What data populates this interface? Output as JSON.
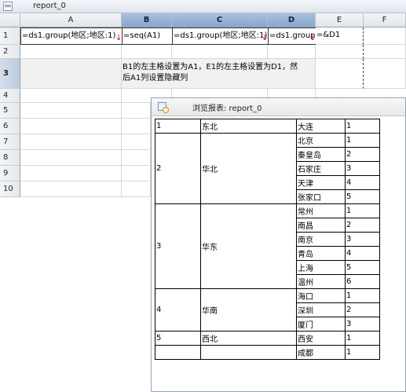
{
  "window": {
    "title": "report_0"
  },
  "columns": [
    "A",
    "B",
    "C",
    "D",
    "E",
    "F"
  ],
  "rows": [
    "1",
    "2",
    "3",
    "4",
    "5",
    "6",
    "7",
    "8",
    "9",
    "10"
  ],
  "cells": {
    "A1": "=ds1.group(地区;地区:1)",
    "B1": "=seq(A1)",
    "C1": "=ds1.group(地区;地区:1)",
    "D1": "=ds1.group(",
    "E1": "=&D1"
  },
  "note": {
    "line1": "B1的左主格设置为A1，E1的左主格设置为D1，然",
    "line2": "后A1列设置隐藏列"
  },
  "preview": {
    "title": "浏览报表: report_0",
    "groups": [
      {
        "seq": "1",
        "region": "东北",
        "cities": [
          {
            "name": "大连",
            "idx": "1"
          }
        ]
      },
      {
        "seq": "2",
        "region": "华北",
        "cities": [
          {
            "name": "北京",
            "idx": "1"
          },
          {
            "name": "秦皇岛",
            "idx": "2"
          },
          {
            "name": "石家庄",
            "idx": "3"
          },
          {
            "name": "天津",
            "idx": "4"
          },
          {
            "name": "张家口",
            "idx": "5"
          }
        ]
      },
      {
        "seq": "3",
        "region": "华东",
        "cities": [
          {
            "name": "常州",
            "idx": "1"
          },
          {
            "name": "南昌",
            "idx": "2"
          },
          {
            "name": "南京",
            "idx": "3"
          },
          {
            "name": "青岛",
            "idx": "4"
          },
          {
            "name": "上海",
            "idx": "5"
          },
          {
            "name": "温州",
            "idx": "6"
          }
        ]
      },
      {
        "seq": "4",
        "region": "华南",
        "cities": [
          {
            "name": "海口",
            "idx": "1"
          },
          {
            "name": "深圳",
            "idx": "2"
          },
          {
            "name": "厦门",
            "idx": "3"
          }
        ]
      },
      {
        "seq": "5",
        "region": "西北",
        "cities": [
          {
            "name": "西安",
            "idx": "1"
          }
        ]
      },
      {
        "seq": "",
        "region": "",
        "cities": [
          {
            "name": "成都",
            "idx": "1"
          }
        ]
      }
    ]
  }
}
